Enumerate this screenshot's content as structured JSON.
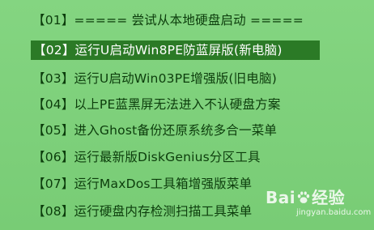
{
  "menu": {
    "items": [
      {
        "label": "【01】===== 尝试从本地硬盘启动 ====="
      },
      {
        "label": "【02】运行U启动Win8PE防蓝屏版(新电脑)"
      },
      {
        "label": "【03】运行U启动Win03PE增强版(旧电脑)"
      },
      {
        "label": "【04】以上PE蓝黑屏无法进入不认硬盘方案"
      },
      {
        "label": "【05】进入Ghost备份还原系统多合一菜单"
      },
      {
        "label": "【06】运行最新版DiskGenius分区工具"
      },
      {
        "label": "【07】运行MaxDos工具箱增强版菜单"
      },
      {
        "label": "【08】运行硬盘内存检测扫描工具菜单"
      }
    ],
    "selected_index": 1
  },
  "watermark": {
    "logo_left": "Bai",
    "logo_right": "经验",
    "url": "jingyan.baidu.com",
    "icon": "baidu-paw-icon"
  },
  "colors": {
    "background": "#7dd07a",
    "text": "#0c3d0c",
    "selected_background": "#2b7a26",
    "selected_text": "#ffffff"
  }
}
